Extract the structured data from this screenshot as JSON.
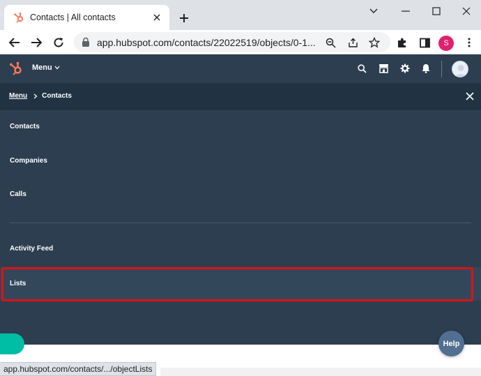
{
  "browser": {
    "tab_title": "Contacts | All contacts",
    "url": "app.hubspot.com/contacts/22022519/objects/0-1...",
    "profile_initial": "S",
    "status_url": "app.hubspot.com/contacts/.../objectLists"
  },
  "hubspot": {
    "menu_label": "Menu",
    "breadcrumb": {
      "parent": "Menu",
      "current": "Contacts"
    },
    "menu_items": [
      "Contacts",
      "Companies",
      "Calls",
      "Activity Feed",
      "Lists"
    ],
    "selected_item": "Lists",
    "help_label": "Help"
  },
  "colors": {
    "nav_bg": "#2d3e50",
    "breadcrumb_bg": "#213343",
    "hubspot_orange": "#ff7a59",
    "highlight_red": "#e11111",
    "help_bg": "#516f90"
  }
}
